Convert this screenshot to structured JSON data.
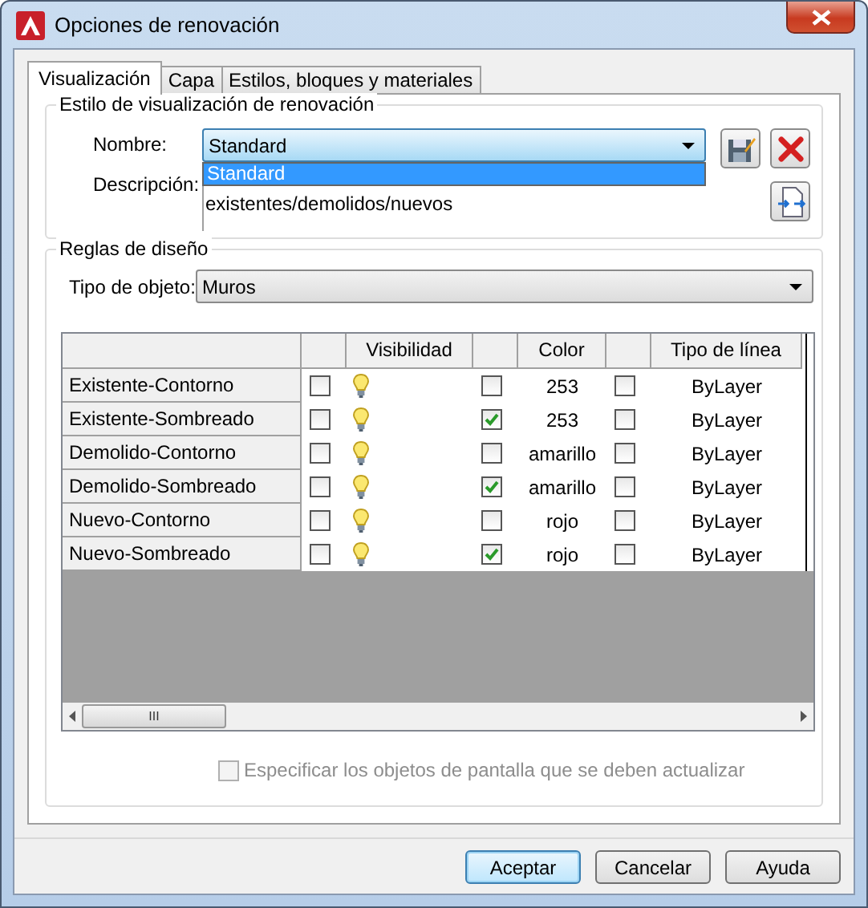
{
  "window": {
    "title": "Opciones de renovación"
  },
  "tabs": [
    {
      "label": "Visualización",
      "selected": true
    },
    {
      "label": "Capa",
      "selected": false
    },
    {
      "label": "Estilos, bloques y materiales",
      "selected": false
    }
  ],
  "style_group": {
    "title": "Estilo de visualización de renovación",
    "name_label": "Nombre:",
    "name_value": "Standard",
    "dropdown_open": true,
    "dropdown_items": [
      {
        "label": "Standard",
        "selected": true
      }
    ],
    "description_label": "Descripción:",
    "description": "existentes/demolidos/nuevos"
  },
  "rules_group": {
    "title": "Reglas de diseño",
    "object_type_label": "Tipo de objeto:",
    "object_type_value": "Muros",
    "table": {
      "columns": [
        "Visibilidad",
        "Color",
        "Tipo de línea"
      ],
      "rows": [
        {
          "name": "Existente-Contorno",
          "visibility_checked": false,
          "color_checked": false,
          "color_value": "253",
          "linetype_checked": false,
          "linetype": "ByLayer"
        },
        {
          "name": "Existente-Sombreado",
          "visibility_checked": false,
          "color_checked": true,
          "color_value": "253",
          "linetype_checked": false,
          "linetype": "ByLayer"
        },
        {
          "name": "Demolido-Contorno",
          "visibility_checked": false,
          "color_checked": false,
          "color_value": "amarillo",
          "linetype_checked": false,
          "linetype": "ByLayer"
        },
        {
          "name": "Demolido-Sombreado",
          "visibility_checked": false,
          "color_checked": true,
          "color_value": "amarillo",
          "linetype_checked": false,
          "linetype": "ByLayer"
        },
        {
          "name": "Nuevo-Contorno",
          "visibility_checked": false,
          "color_checked": false,
          "color_value": "rojo",
          "linetype_checked": false,
          "linetype": "ByLayer"
        },
        {
          "name": "Nuevo-Sombreado",
          "visibility_checked": false,
          "color_checked": true,
          "color_value": "rojo",
          "linetype_checked": false,
          "linetype": "ByLayer"
        }
      ],
      "scrollbar_glyph": "III"
    },
    "update_option": {
      "label": "Especificar los objetos de pantalla que se deben actualizar",
      "checked": false,
      "disabled": true
    }
  },
  "buttons": [
    {
      "label": "Aceptar",
      "default": true
    },
    {
      "label": "Cancelar",
      "default": false
    },
    {
      "label": "Ayuda",
      "default": false
    }
  ]
}
